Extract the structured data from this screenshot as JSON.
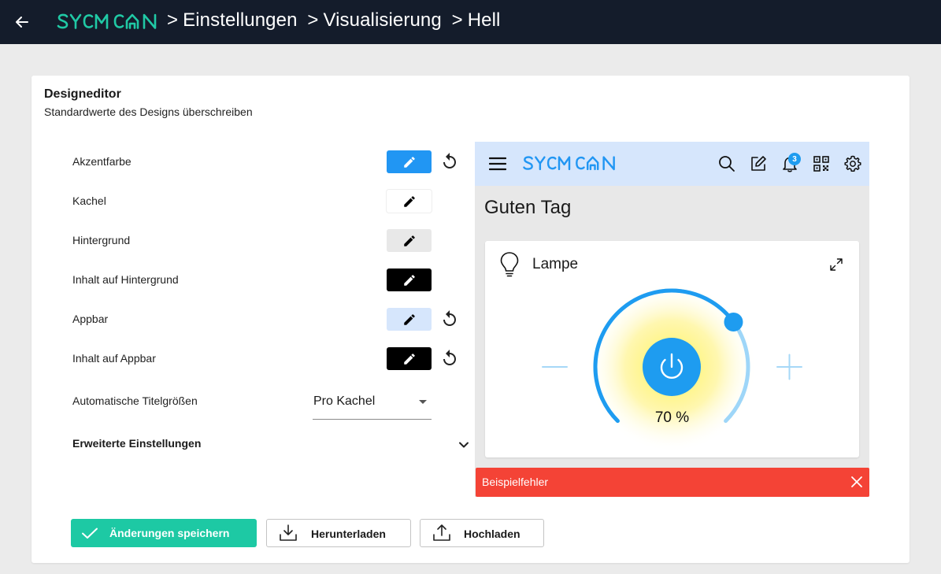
{
  "header": {
    "brand": "SYMCON",
    "breadcrumb": [
      "Einstellungen",
      "Visualisierung",
      "Hell"
    ],
    "separator": ">"
  },
  "editor": {
    "title": "Designeditor",
    "subtitle": "Standardwerte des Designs überschreiben",
    "rows": [
      {
        "label": "Akzentfarbe",
        "color": "#2196f3",
        "reset": true
      },
      {
        "label": "Kachel",
        "color": "#ffffff",
        "reset": false
      },
      {
        "label": "Hintergrund",
        "color": "#e8e8e8",
        "reset": false
      },
      {
        "label": "Inhalt auf Hintergrund",
        "color": "#000000",
        "reset": false
      },
      {
        "label": "Appbar",
        "color": "#d6e6fc",
        "reset": true
      },
      {
        "label": "Inhalt auf Appbar",
        "color": "#000000",
        "reset": true
      }
    ],
    "title_size": {
      "label": "Automatische Titelgrößen",
      "value": "Pro Kachel"
    },
    "advanced": {
      "label": "Erweiterte Einstellungen"
    }
  },
  "preview": {
    "brand": "SYMCON",
    "notifications": "3",
    "greeting": "Guten Tag",
    "tile": {
      "title": "Lampe",
      "value_label": "70 %",
      "level": 70
    },
    "error": "Beispielfehler"
  },
  "actions": {
    "save": "Änderungen speichern",
    "download": "Herunterladen",
    "upload": "Hochladen"
  },
  "colors": {
    "topbar": "#141c2b",
    "brand_teal": "#20c9a5",
    "accent": "#2196f3",
    "save": "#1dc9a4",
    "error": "#f44336"
  }
}
